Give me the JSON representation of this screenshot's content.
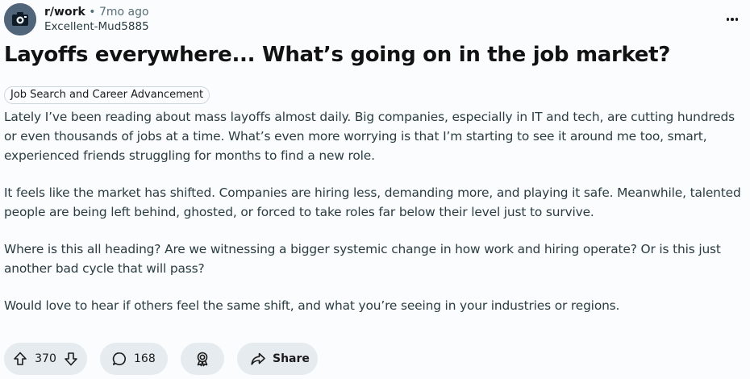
{
  "post": {
    "subreddit": "r/work",
    "separator": "•",
    "time_ago": "7mo ago",
    "author": "Excellent-Mud5885",
    "title": "Layoffs everywhere... What’s going on in the job market?",
    "flair": "Job Search and Career Advancement",
    "paragraphs": [
      "Lately I’ve been reading about mass layoffs almost daily. Big companies, especially in IT and tech, are cutting hundreds or even thousands of jobs at a time. What’s even more worrying is that I’m starting to see it around me too, smart, experienced friends struggling for months to find a new role.",
      "It feels like the market has shifted. Companies are hiring less, demanding more, and playing it safe. Meanwhile, talented people are being left behind, ghosted, or forced to take roles far below their level just to survive.",
      "Where is this all heading? Are we witnessing a bigger systemic change in how work and hiring operate? Or is this just another bad cycle that will pass?",
      "Would love to hear if others feel the same shift, and what you’re seeing in your industries or regions."
    ]
  },
  "actions": {
    "vote_count": "370",
    "comment_count": "168",
    "share_label": "Share"
  },
  "icons": {
    "avatar": "camera-avatar-icon",
    "menu": "overflow-menu-icon",
    "upvote": "upvote-arrow-icon",
    "downvote": "downvote-arrow-icon",
    "comment": "comment-bubble-icon",
    "award": "award-icon",
    "share": "share-arrow-icon"
  },
  "colors": {
    "background": "#fbfcfd",
    "pill_background": "#e5ebee",
    "avatar_background": "#51657a",
    "meta_gray": "#576f76"
  }
}
